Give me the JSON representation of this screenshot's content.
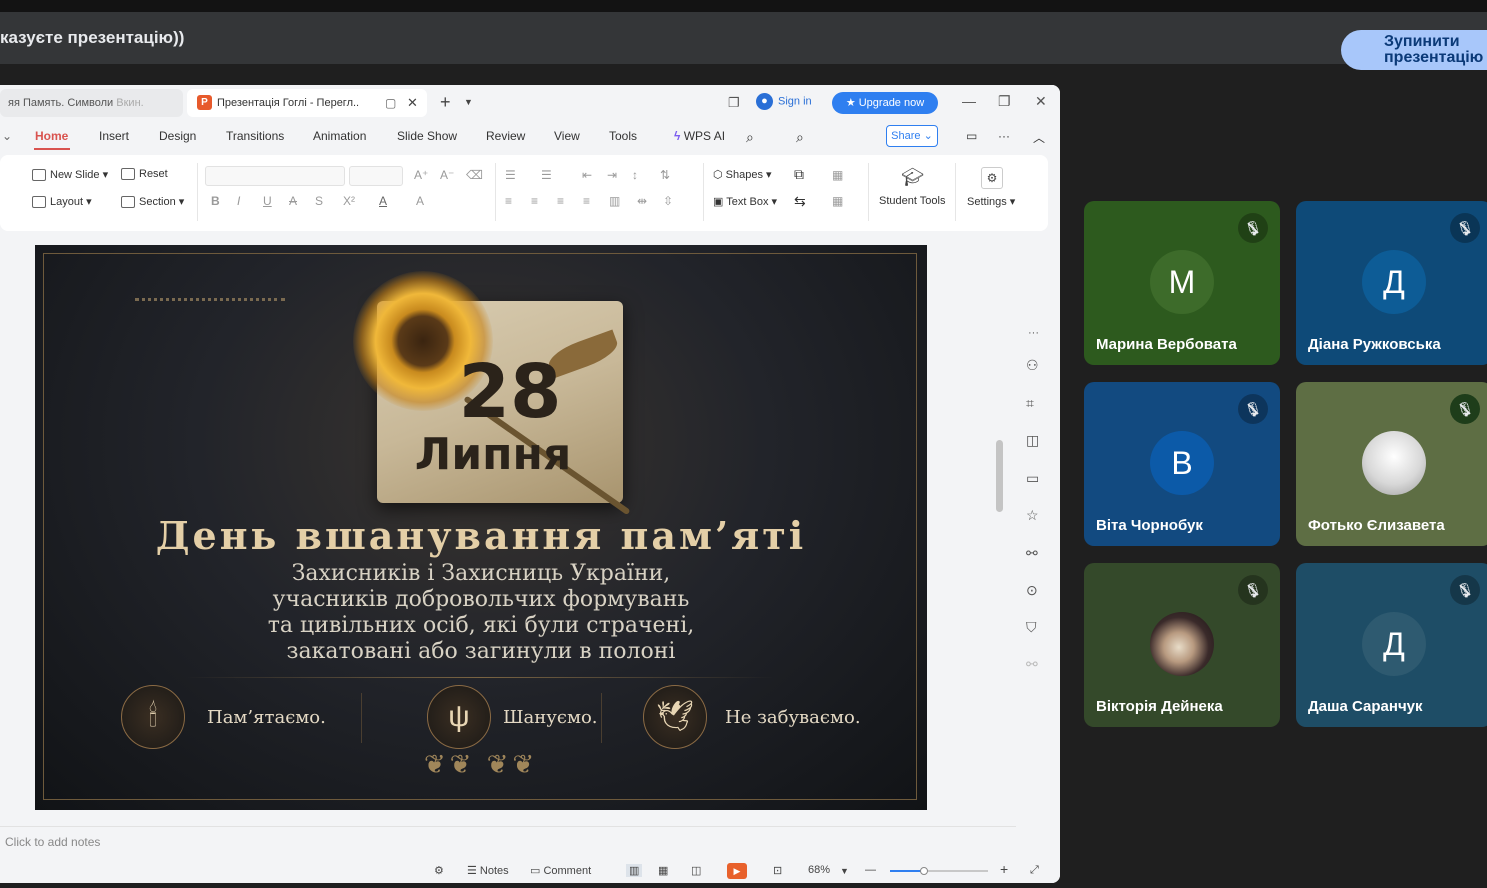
{
  "banner": {
    "text": "казуєте презентацію))",
    "stop_button_line1": "Зупинити",
    "stop_button_line2": "презентацію"
  },
  "wps": {
    "tabs": [
      {
        "label": "яя Память. Символи",
        "faded": "Вкин."
      },
      {
        "label": "Презентація Гоглі - Перегл..",
        "icon": "P"
      }
    ],
    "sign_in": "Sign in",
    "upgrade": "Upgrade now",
    "menu": [
      "Home",
      "Insert",
      "Design",
      "Transitions",
      "Animation",
      "Slide Show",
      "Review",
      "View",
      "Tools"
    ],
    "wps_ai": "WPS AI",
    "share": "Share",
    "ribbon": {
      "new_slide": "New Slide",
      "reset": "Reset",
      "layout": "Layout",
      "section": "Section",
      "shapes": "Shapes",
      "text_box": "Text Box",
      "student_tools": "Student Tools",
      "settings": "Settings"
    },
    "notes_placeholder": "Click to add notes",
    "status": {
      "notes": "Notes",
      "comment": "Comment",
      "zoom": "68%",
      "zoom_fraction": 0.33
    }
  },
  "slide": {
    "day": "28",
    "month": "Липня",
    "title": "День вшанування пам’яті",
    "subtitle_lines": [
      "Захисників і Захисниць України,",
      "учасників добровольчих формувань",
      "та цивільних осіб, які були страчені,",
      "закатовані або загинули в полоні"
    ],
    "mottos": [
      "Пам’ятаємо.",
      "Шануємо.",
      "Не забуваємо."
    ]
  },
  "participants": [
    {
      "name": "Марина Вербовата",
      "initial": "М",
      "bg": "#2d5a1e",
      "avatar": "#3d6b2a",
      "muted": true
    },
    {
      "name": "Діана Ружковська",
      "initial": "Д",
      "bg": "#0e4a78",
      "avatar": "#0d5c96",
      "muted": true
    },
    {
      "name": "Віта Чорнобук",
      "initial": "В",
      "bg": "#124a80",
      "avatar": "#0c5aa8",
      "muted": true
    },
    {
      "name": "Фотько Єлизавета",
      "initial": "",
      "bg": "#5e6e44",
      "avatar": "#e6e6e6",
      "muted": true
    },
    {
      "name": "Вікторія Дейнека",
      "initial": "",
      "bg": "#34492a",
      "avatar": "#3a2a2a",
      "muted": true
    },
    {
      "name": "Даша Саранчук",
      "initial": "Д",
      "bg": "#1e4d66",
      "avatar": "#2e5a70",
      "muted": true
    }
  ]
}
